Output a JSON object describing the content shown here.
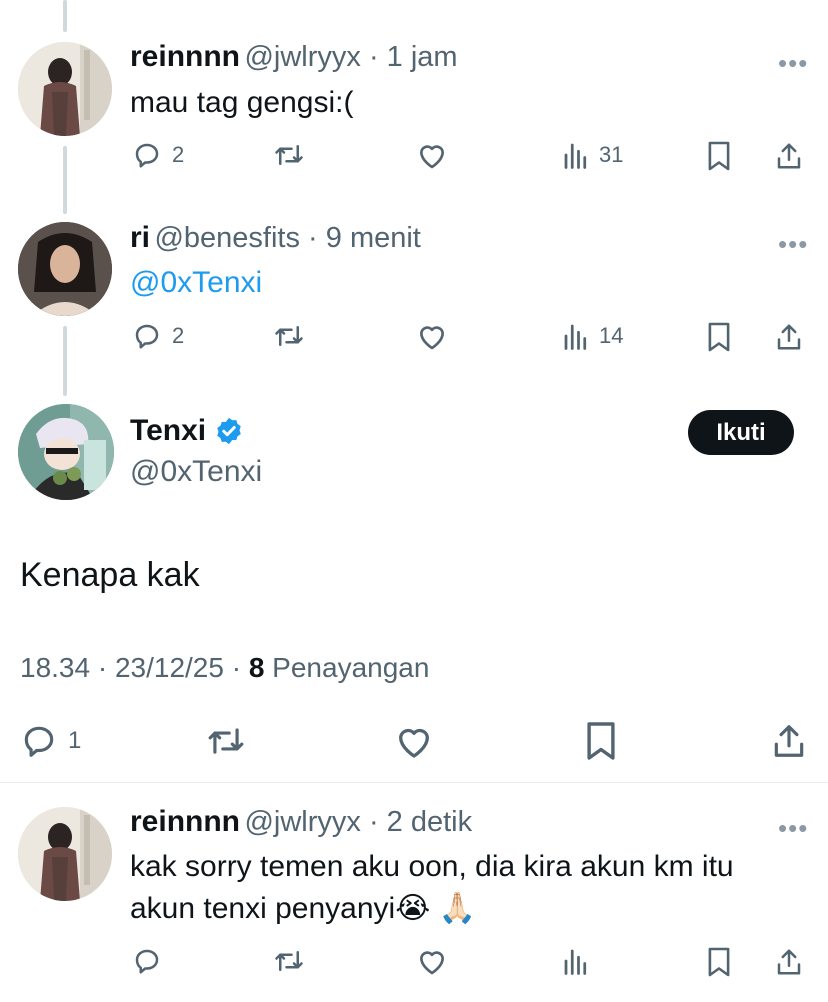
{
  "tweets": [
    {
      "name": "reinnnn",
      "handle": "@jwlryyx",
      "time": "1 jam",
      "text": "mau tag gengsi:(",
      "reply_count": "2",
      "view_count": "31"
    },
    {
      "name": "ri",
      "handle": "@benesfits",
      "time": "9 menit",
      "text": "@0xTenxi",
      "reply_count": "2",
      "view_count": "14"
    }
  ],
  "main_post": {
    "name": "Tenxi",
    "handle": "@0xTenxi",
    "follow_label": "Ikuti",
    "text": "Kenapa kak",
    "time_date": "18.34 · 23/12/25 · ",
    "views_number": "8",
    "views_label": " Penayangan",
    "reply_count": "1"
  },
  "reply": {
    "name": "reinnnn",
    "handle": "@jwlryyx",
    "time": "2 detik",
    "line1": "kak sorry temen aku oon, dia kira akun km itu",
    "line2": "akun tenxi penyanyi",
    "emoji1": "😭",
    "emoji2": "🙏🏻"
  },
  "separator": " · ",
  "more_label": "•••",
  "colors": {
    "accent": "#1d9bf0",
    "text": "#0f1419",
    "muted": "#536471",
    "verified": "#1d9bf0"
  },
  "icons": [
    "reply-icon",
    "retweet-icon",
    "like-icon",
    "views-icon",
    "bookmark-icon",
    "share-icon",
    "verified-badge-icon",
    "more-icon"
  ]
}
